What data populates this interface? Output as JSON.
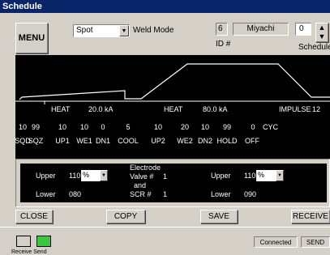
{
  "window": {
    "title": "Schedule"
  },
  "toolbar": {
    "menu_label": "MENU",
    "weld_type_value": "Spot",
    "weld_mode_label": "Weld Mode",
    "id_value": "6",
    "id_label": "ID #",
    "name_value": "Miyachi",
    "schedule_value": "0",
    "schedule_label": "Schedule"
  },
  "profile": {
    "heat1_label": "HEAT",
    "heat1_value": "20.0 kA",
    "heat2_label": "HEAT",
    "heat2_value": "80.0 kA",
    "impulse_label": "IMPULSE",
    "impulse_value": "12",
    "params": [
      {
        "value": "10",
        "label": "SQD"
      },
      {
        "value": "99",
        "label": "SQZ"
      },
      {
        "value": "10",
        "label": "UP1"
      },
      {
        "value": "10",
        "label": "WE1"
      },
      {
        "value": "0",
        "label": "DN1"
      },
      {
        "value": "5",
        "label": "COOL"
      },
      {
        "value": "10",
        "label": "UP2"
      },
      {
        "value": "20",
        "label": "WE2"
      },
      {
        "value": "10",
        "label": "DN2"
      },
      {
        "value": "99",
        "label": "HOLD"
      },
      {
        "value": "0",
        "label": "OFF"
      }
    ],
    "unit_label": "CYC"
  },
  "limits": {
    "upper_label": "Upper",
    "lower_label": "Lower",
    "left_upper_value": "110",
    "left_upper_unit": "%",
    "left_lower_value": "080",
    "electrode_line1": "Electrode",
    "electrode_line2": "Valve #",
    "electrode_value": "1",
    "and_label": "and",
    "scr_label": "SCR #",
    "scr_value": "1",
    "right_upper_value": "110",
    "right_upper_unit": "%",
    "right_lower_value": "090"
  },
  "actions": {
    "close_label": "CLOSE",
    "copy_label": "COPY",
    "save_label": "SAVE",
    "receive_label": "RECEIVE"
  },
  "status": {
    "receive_send_label": "Receive Send",
    "connection_text": "Connected",
    "send_label": "SEND",
    "receive_indicator_color": "#d4d0c8",
    "send_indicator_color": "#3cc83c"
  },
  "colors": {
    "title_bar": "#0a246a",
    "panel_background": "#000000",
    "waveform": "#ffffff"
  }
}
